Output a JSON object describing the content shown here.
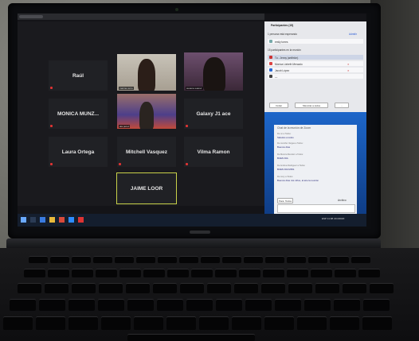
{
  "meeting": {
    "tiles": [
      {
        "id": "raul",
        "name": "Raúl"
      },
      {
        "id": "video1",
        "name": "",
        "tag": "marina cerro"
      },
      {
        "id": "video2",
        "name": "",
        "tag": "susana suarez"
      },
      {
        "id": "monica",
        "name": "MONICA MUNZ..."
      },
      {
        "id": "video3",
        "name": "",
        "tag": "ala perez"
      },
      {
        "id": "galaxy",
        "name": "Galaxy J1 ace"
      },
      {
        "id": "laura",
        "name": "Laura Ortega"
      },
      {
        "id": "mitchell",
        "name": "Mitchell Vasquez"
      },
      {
        "id": "vilma",
        "name": "Vilma Ramon"
      },
      {
        "id": "jaime",
        "name": "JAIME LOOR"
      }
    ]
  },
  "participants_panel": {
    "title": "Participantes (15)",
    "waiting_label": "1 persona está esperando",
    "admit_label": "Admitir",
    "waiting_person": "emily torres",
    "in_meeting_label": "15 participantes en la reunión",
    "rows": [
      "Tu - Jenny (anfitrión)",
      "Monica Lizbeth Mercado",
      "Jacob López",
      "—"
    ],
    "buttons": [
      "Invitar",
      "Silenciar a todos",
      "..."
    ]
  },
  "chat_panel": {
    "title": "Chat de la reunión de Zoom",
    "messages": [
      {
        "from": "De mí a Todos:",
        "text": "Saludos a todos"
      },
      {
        "from": "De Jennifer Vargas a Todos:",
        "text": "Buenos días"
      },
      {
        "from": "De Monica Mendez a Todos:",
        "text": "BUEN DIA"
      },
      {
        "from": "De Andrea Rodriguez a Todos:",
        "text": "BUEN DIA MISS"
      },
      {
        "from": "De Jeny a Todos:",
        "text": "Buenos días mis niños, al aire la reunión"
      }
    ],
    "to_label": "Para: Todos",
    "file_label": "Archivo"
  },
  "taskbar": {
    "time": "11:08",
    "date": "21/4/2020",
    "lang": "ESP"
  },
  "colors": {
    "active_speaker": "#c9d24a",
    "screen_bg": "#141418",
    "tile_bg": "#202125",
    "taskbar_bg": "#141e2e"
  }
}
